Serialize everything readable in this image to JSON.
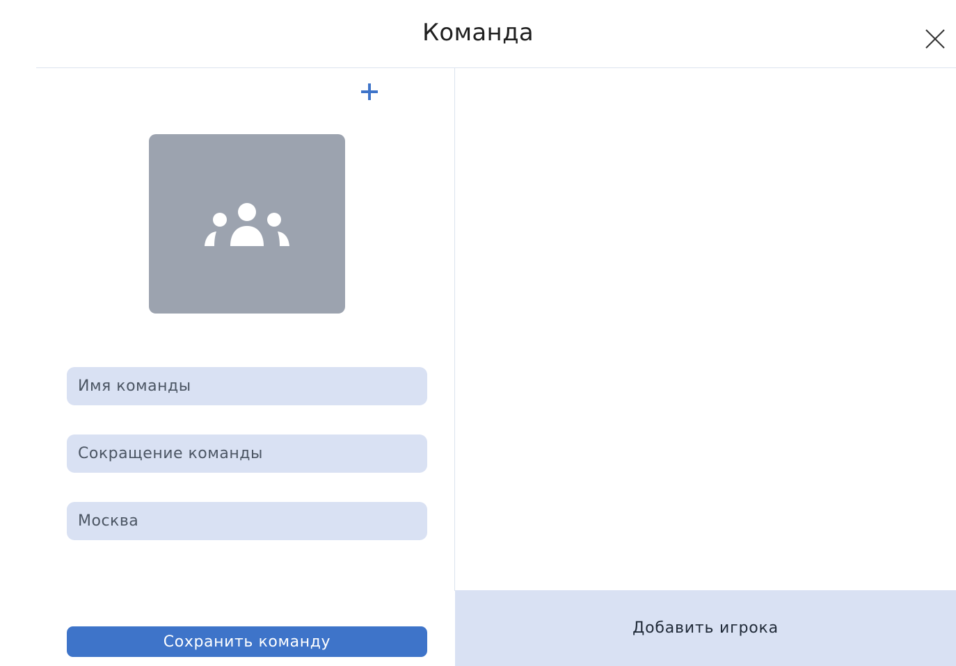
{
  "modal": {
    "title": "Команда"
  },
  "icons": {
    "close": "close-icon",
    "add_photo": "plus-icon",
    "team_placeholder": "team-icon"
  },
  "form": {
    "team_name_placeholder": "Имя команды",
    "team_short_placeholder": "Сокращение команды",
    "city_value": "Москва",
    "save_label": "Сохранить команду"
  },
  "players": {
    "add_label": "Добавить игрока"
  },
  "colors": {
    "accent": "#3e74c9",
    "field_bg": "#d9e1f3",
    "avatar_bg": "#9ca3af"
  }
}
